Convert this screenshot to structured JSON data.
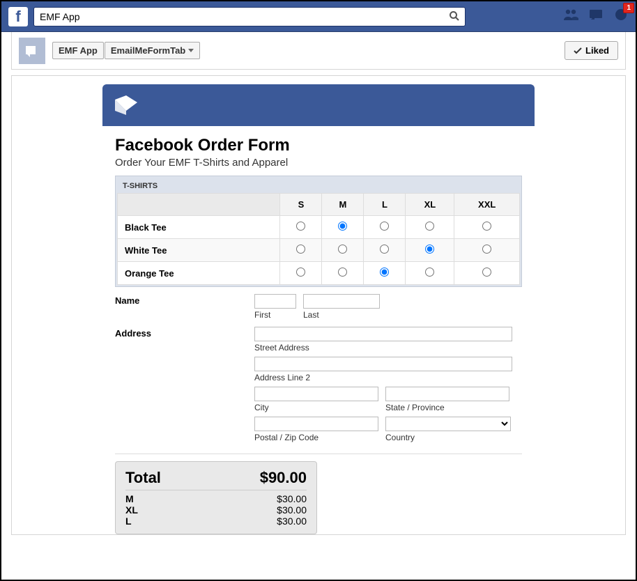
{
  "topbar": {
    "search_value": "EMF App",
    "notification_count": "1"
  },
  "page_header": {
    "app_name": "EMF App",
    "tab_name": "EmailMeFormTab",
    "liked_label": "Liked"
  },
  "form": {
    "title": "Facebook Order Form",
    "subtitle": "Order Your EMF T-Shirts and Apparel",
    "tshirts": {
      "section_label": "T-SHIRTS",
      "sizes": [
        "S",
        "M",
        "L",
        "XL",
        "XXL"
      ],
      "rows": [
        {
          "label": "Black Tee",
          "selected": "M"
        },
        {
          "label": "White Tee",
          "selected": "XL"
        },
        {
          "label": "Orange Tee",
          "selected": "L"
        }
      ]
    },
    "name": {
      "label": "Name",
      "first_label": "First",
      "last_label": "Last"
    },
    "address": {
      "label": "Address",
      "street_label": "Street Address",
      "line2_label": "Address Line 2",
      "city_label": "City",
      "state_label": "State / Province",
      "postal_label": "Postal / Zip Code",
      "country_label": "Country"
    },
    "total": {
      "label": "Total",
      "amount": "$90.00",
      "lines": [
        {
          "label": "M",
          "amount": "$30.00"
        },
        {
          "label": "XL",
          "amount": "$30.00"
        },
        {
          "label": "L",
          "amount": "$30.00"
        }
      ]
    }
  }
}
